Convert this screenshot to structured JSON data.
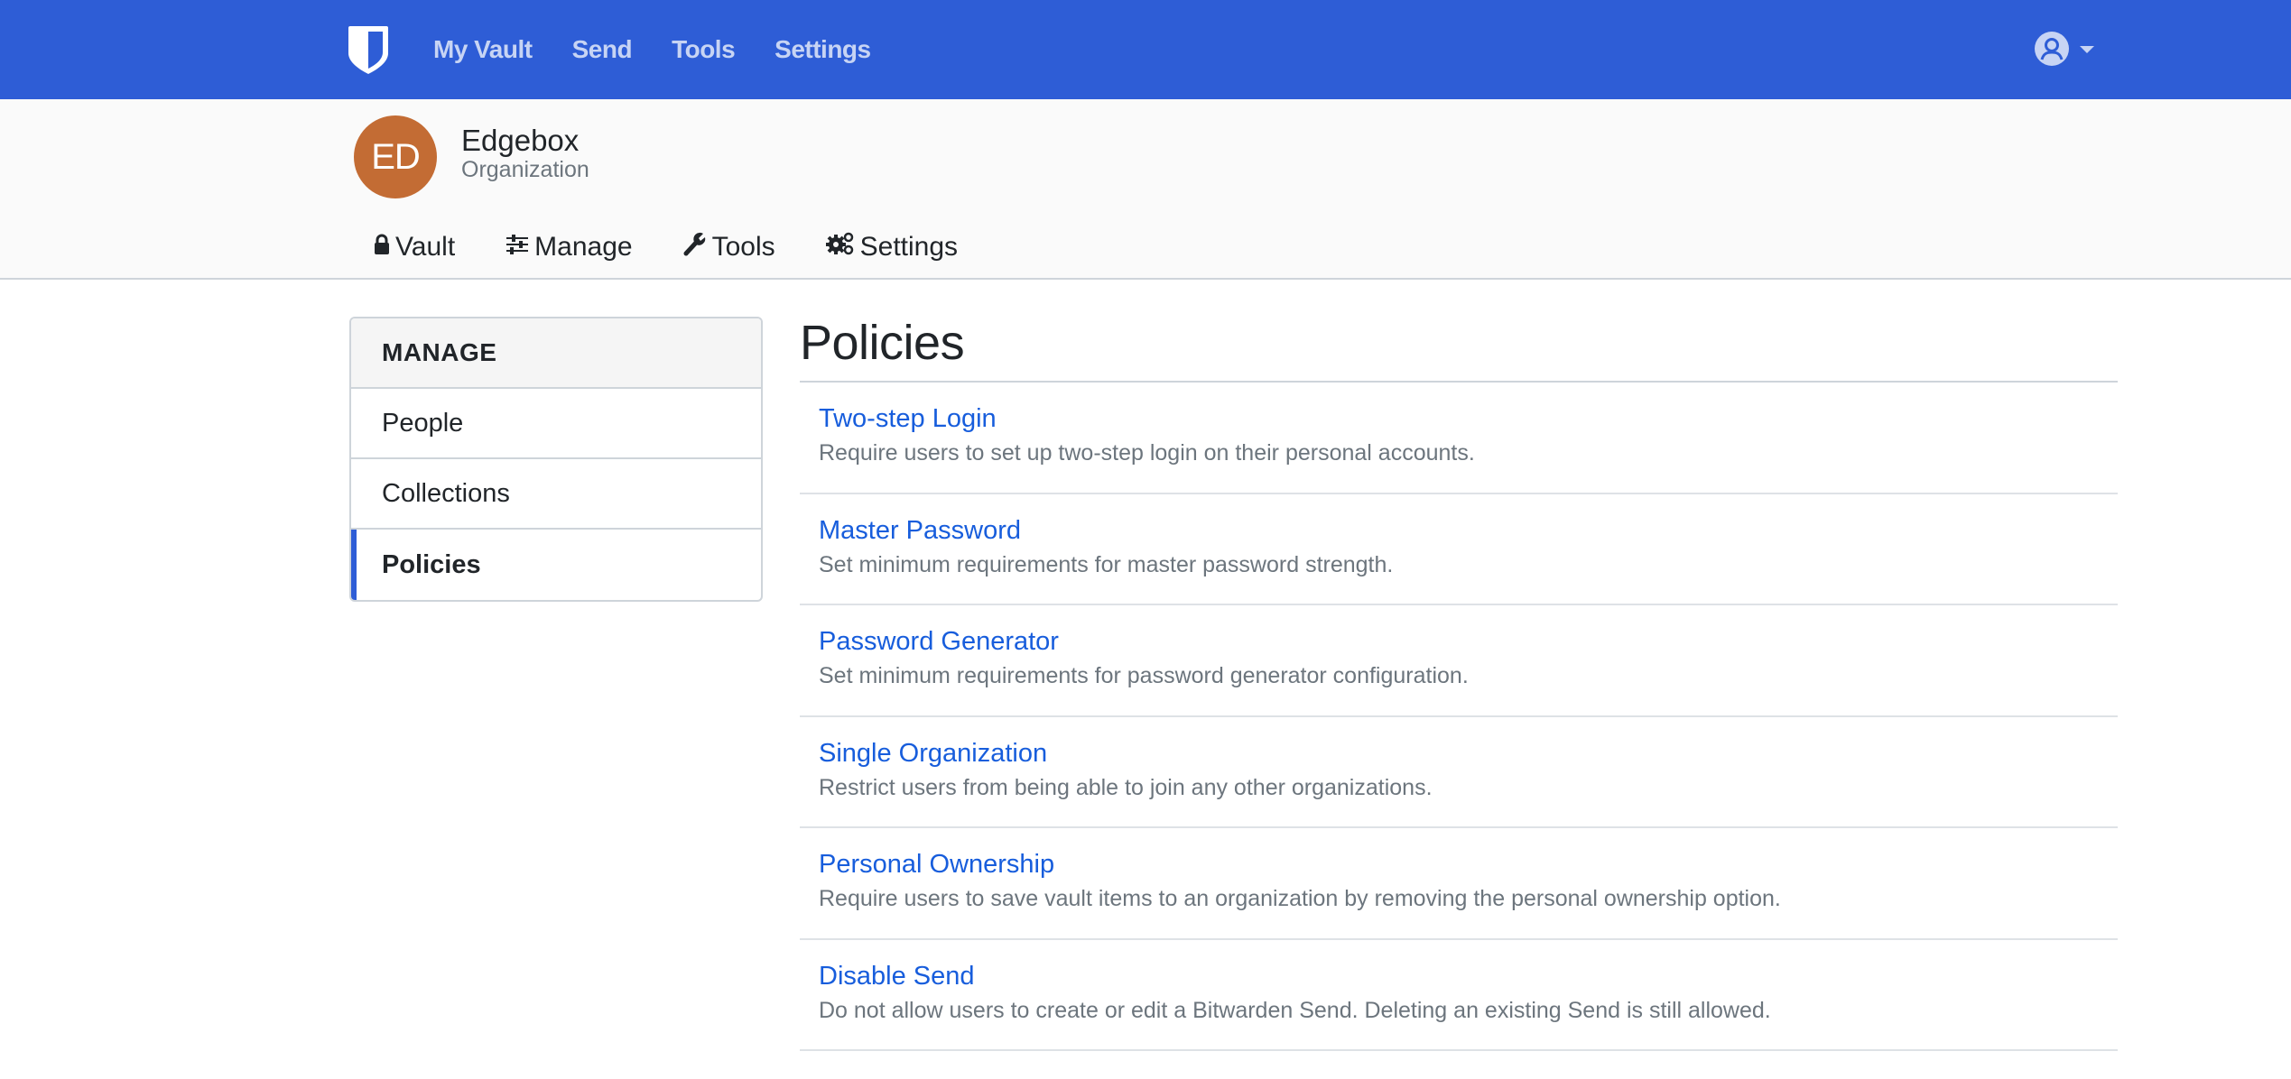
{
  "navbar": {
    "brand_icon": "bitwarden-shield-icon",
    "links": [
      {
        "label": "My Vault"
      },
      {
        "label": "Send"
      },
      {
        "label": "Tools"
      },
      {
        "label": "Settings"
      }
    ],
    "user_menu_icon": "user-circle-icon",
    "user_menu_caret": "caret-down-icon",
    "bg_color": "#2e5dd6"
  },
  "org": {
    "initials": "ED",
    "name": "Edgebox",
    "type": "Organization",
    "avatar_color": "#c36c34",
    "tabs": [
      {
        "label": "Vault",
        "icon": "lock-icon"
      },
      {
        "label": "Manage",
        "icon": "sliders-icon"
      },
      {
        "label": "Tools",
        "icon": "wrench-icon"
      },
      {
        "label": "Settings",
        "icon": "cogs-icon"
      }
    ]
  },
  "sidebar": {
    "heading": "MANAGE",
    "items": [
      {
        "label": "People",
        "active": false
      },
      {
        "label": "Collections",
        "active": false
      },
      {
        "label": "Policies",
        "active": true
      }
    ]
  },
  "main": {
    "title": "Policies",
    "policies": [
      {
        "name": "Two-step Login",
        "description": "Require users to set up two-step login on their personal accounts."
      },
      {
        "name": "Master Password",
        "description": "Set minimum requirements for master password strength."
      },
      {
        "name": "Password Generator",
        "description": "Set minimum requirements for password generator configuration."
      },
      {
        "name": "Single Organization",
        "description": "Restrict users from being able to join any other organizations."
      },
      {
        "name": "Personal Ownership",
        "description": "Require users to save vault items to an organization by removing the personal ownership option."
      },
      {
        "name": "Disable Send",
        "description": "Do not allow users to create or edit a Bitwarden Send. Deleting an existing Send is still allowed."
      }
    ]
  }
}
